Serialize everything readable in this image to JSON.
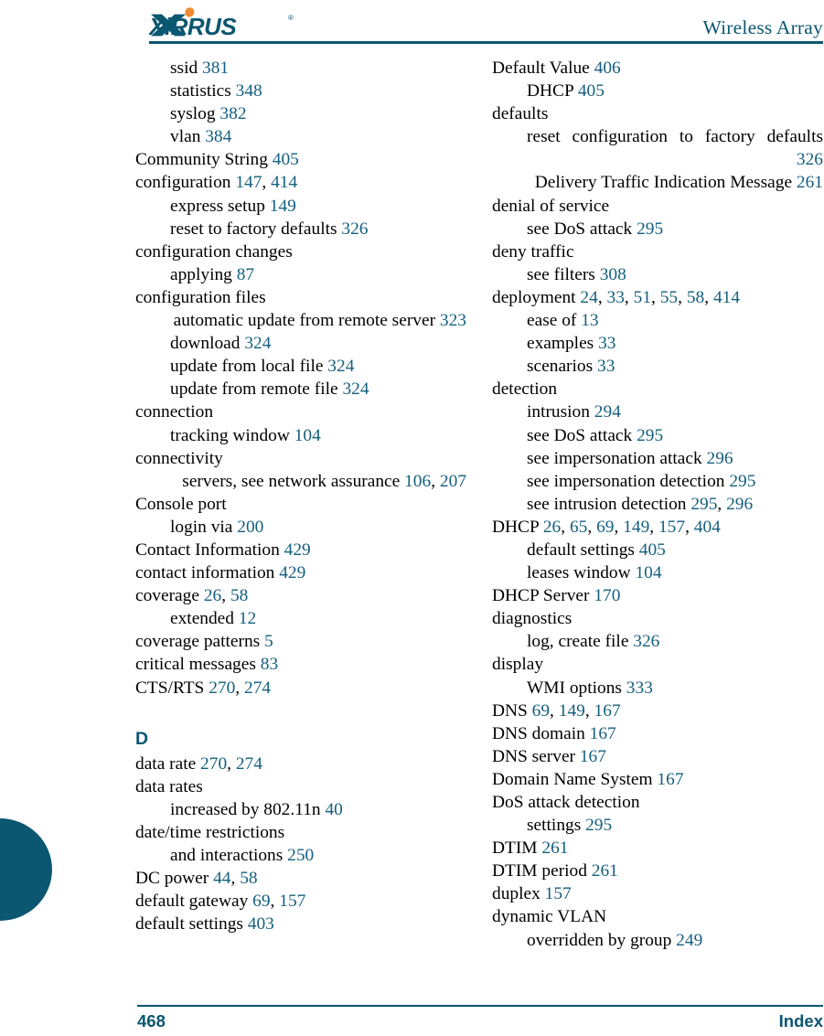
{
  "header": {
    "logo_text": "XIRRUS",
    "logo_name": "xirrus-logo",
    "title": "Wireless Array",
    "rule_color": "#0b5670"
  },
  "footer": {
    "page_number": "468",
    "label": "Index",
    "color": "#0b5670"
  },
  "colors": {
    "teal": "#0b5670",
    "page_number_link": "#145f7e",
    "orange": "#f08a33",
    "text": "#000000"
  },
  "index": {
    "left_column": [
      {
        "level": 1,
        "text": "ssid",
        "pages": [
          "381"
        ]
      },
      {
        "level": 1,
        "text": "statistics",
        "pages": [
          "348"
        ]
      },
      {
        "level": 1,
        "text": "syslog",
        "pages": [
          "382"
        ]
      },
      {
        "level": 1,
        "text": "vlan",
        "pages": [
          "384"
        ]
      },
      {
        "level": 0,
        "text": "Community String",
        "pages": [
          "405"
        ]
      },
      {
        "level": 0,
        "text": "configuration",
        "pages": [
          "147",
          "414"
        ]
      },
      {
        "level": 1,
        "text": "express setup",
        "pages": [
          "149"
        ]
      },
      {
        "level": 1,
        "text": "reset to factory defaults",
        "pages": [
          "326"
        ]
      },
      {
        "level": 0,
        "text": "configuration changes",
        "pages": []
      },
      {
        "level": 1,
        "text": "applying",
        "pages": [
          "87"
        ]
      },
      {
        "level": 0,
        "text": "configuration files",
        "pages": []
      },
      {
        "level": 1,
        "wrap": true,
        "justify": true,
        "text": "automatic update from remote server",
        "pages": [
          "323"
        ]
      },
      {
        "level": 1,
        "text": "download",
        "pages": [
          "324"
        ]
      },
      {
        "level": 1,
        "text": "update from local file",
        "pages": [
          "324"
        ]
      },
      {
        "level": 1,
        "text": "update from remote file",
        "pages": [
          "324"
        ]
      },
      {
        "level": 0,
        "text": "connection",
        "pages": []
      },
      {
        "level": 1,
        "text": "tracking window",
        "pages": [
          "104"
        ]
      },
      {
        "level": 0,
        "text": "connectivity",
        "pages": []
      },
      {
        "level": 1,
        "wrap": true,
        "justify": true,
        "text": "servers, see network assurance",
        "pages": [
          "106",
          "207"
        ]
      },
      {
        "level": 0,
        "text": "Console port",
        "pages": []
      },
      {
        "level": 1,
        "text": "login via",
        "pages": [
          "200"
        ]
      },
      {
        "level": 0,
        "text": "Contact Information",
        "pages": [
          "429"
        ]
      },
      {
        "level": 0,
        "text": "contact information",
        "pages": [
          "429"
        ]
      },
      {
        "level": 0,
        "text": "coverage",
        "pages": [
          "26",
          "58"
        ]
      },
      {
        "level": 1,
        "text": "extended",
        "pages": [
          "12"
        ]
      },
      {
        "level": 0,
        "text": "coverage patterns",
        "pages": [
          "5"
        ]
      },
      {
        "level": 0,
        "text": "critical messages",
        "pages": [
          "83"
        ]
      },
      {
        "level": 0,
        "text": "CTS/RTS",
        "pages": [
          "270",
          "274"
        ]
      },
      {
        "heading": "D"
      },
      {
        "level": 0,
        "text": "data rate",
        "pages": [
          "270",
          "274"
        ]
      },
      {
        "level": 0,
        "text": "data rates",
        "pages": []
      },
      {
        "level": 1,
        "text": "increased by 802.11n",
        "pages": [
          "40"
        ]
      },
      {
        "level": 0,
        "text": "date/time restrictions",
        "pages": []
      },
      {
        "level": 1,
        "text": "and interactions",
        "pages": [
          "250"
        ]
      },
      {
        "level": 0,
        "text": "DC power",
        "pages": [
          "44",
          "58"
        ]
      },
      {
        "level": 0,
        "text": "default gateway",
        "pages": [
          "69",
          "157"
        ]
      },
      {
        "level": 0,
        "text": "default settings",
        "pages": [
          "403"
        ]
      }
    ],
    "right_column": [
      {
        "level": 0,
        "text": "Default Value",
        "pages": [
          "406"
        ]
      },
      {
        "level": 1,
        "text": "DHCP",
        "pages": [
          "405"
        ]
      },
      {
        "level": 0,
        "text": "defaults",
        "pages": []
      },
      {
        "level": 1,
        "wrap": true,
        "justify": true,
        "text": "reset configuration to factory defaults",
        "pages": [
          "326"
        ]
      },
      {
        "level": 0,
        "wrap": true,
        "justify": true,
        "text": "Delivery Traffic Indication Message",
        "pages": [
          "261"
        ]
      },
      {
        "level": 0,
        "text": "denial of service",
        "pages": []
      },
      {
        "level": 1,
        "text": "see DoS attack",
        "pages": [
          "295"
        ]
      },
      {
        "level": 0,
        "text": "deny traffic",
        "pages": []
      },
      {
        "level": 1,
        "text": "see filters",
        "pages": [
          "308"
        ]
      },
      {
        "level": 0,
        "text": "deployment",
        "pages": [
          "24",
          "33",
          "51",
          "55",
          "58",
          "414"
        ]
      },
      {
        "level": 1,
        "text": "ease of",
        "pages": [
          "13"
        ]
      },
      {
        "level": 1,
        "text": "examples",
        "pages": [
          "33"
        ]
      },
      {
        "level": 1,
        "text": "scenarios",
        "pages": [
          "33"
        ]
      },
      {
        "level": 0,
        "text": "detection",
        "pages": []
      },
      {
        "level": 1,
        "text": "intrusion",
        "pages": [
          "294"
        ]
      },
      {
        "level": 1,
        "text": "see DoS attack",
        "pages": [
          "295"
        ]
      },
      {
        "level": 1,
        "text": "see impersonation attack",
        "pages": [
          "296"
        ]
      },
      {
        "level": 1,
        "text": "see impersonation detection",
        "pages": [
          "295"
        ]
      },
      {
        "level": 1,
        "text": "see intrusion detection",
        "pages": [
          "295",
          "296"
        ]
      },
      {
        "level": 0,
        "text": "DHCP",
        "pages": [
          "26",
          "65",
          "69",
          "149",
          "157",
          "404"
        ]
      },
      {
        "level": 1,
        "text": "default settings",
        "pages": [
          "405"
        ]
      },
      {
        "level": 1,
        "text": "leases window",
        "pages": [
          "104"
        ]
      },
      {
        "level": 0,
        "text": "DHCP Server",
        "pages": [
          "170"
        ]
      },
      {
        "level": 0,
        "text": "diagnostics",
        "pages": []
      },
      {
        "level": 1,
        "text": "log, create file",
        "pages": [
          "326"
        ]
      },
      {
        "level": 0,
        "text": "display",
        "pages": []
      },
      {
        "level": 1,
        "text": "WMI options",
        "pages": [
          "333"
        ]
      },
      {
        "level": 0,
        "text": "DNS",
        "pages": [
          "69",
          "149",
          "167"
        ]
      },
      {
        "level": 0,
        "text": "DNS domain",
        "pages": [
          "167"
        ]
      },
      {
        "level": 0,
        "text": "DNS server",
        "pages": [
          "167"
        ]
      },
      {
        "level": 0,
        "text": "Domain Name System",
        "pages": [
          "167"
        ]
      },
      {
        "level": 0,
        "text": "DoS attack detection",
        "pages": []
      },
      {
        "level": 1,
        "text": "settings",
        "pages": [
          "295"
        ]
      },
      {
        "level": 0,
        "text": "DTIM",
        "pages": [
          "261"
        ]
      },
      {
        "level": 0,
        "text": "DTIM period",
        "pages": [
          "261"
        ]
      },
      {
        "level": 0,
        "text": "duplex",
        "pages": [
          "157"
        ]
      },
      {
        "level": 0,
        "text": "dynamic VLAN",
        "pages": []
      },
      {
        "level": 1,
        "text": "overridden by group",
        "pages": [
          "249"
        ]
      }
    ]
  }
}
